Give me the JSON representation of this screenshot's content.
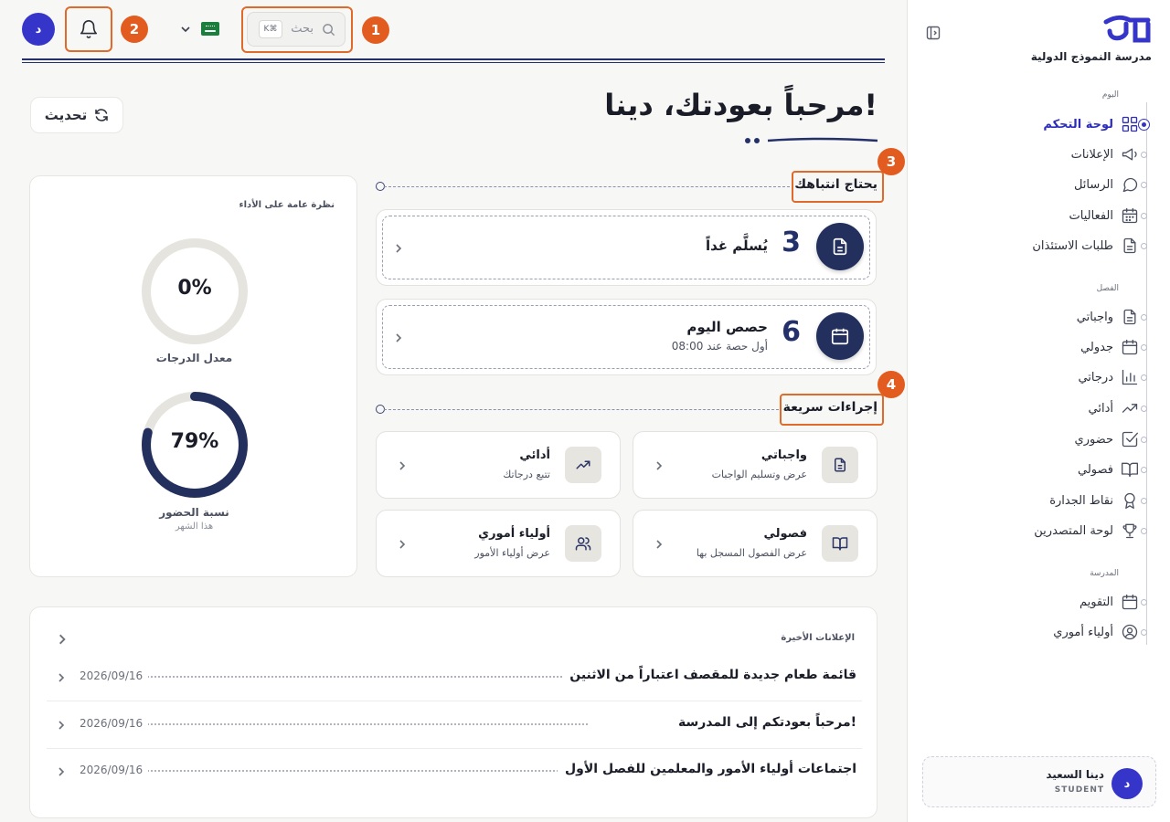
{
  "sidebar": {
    "school_name": "مدرسة النموذج الدولية",
    "sections": {
      "today": "اليوم",
      "class": "الفصل",
      "school": "المدرسة"
    },
    "items": [
      {
        "label": "لوحة التحكم",
        "icon": "dashboard-grid-icon",
        "active": true
      },
      {
        "label": "الإعلانات",
        "icon": "megaphone-icon"
      },
      {
        "label": "الرسائل",
        "icon": "message-bubble-icon"
      },
      {
        "label": "الفعاليات",
        "icon": "calendar-grid-icon"
      },
      {
        "label": "طلبات الاستئذان",
        "icon": "document-icon"
      },
      {
        "label": "واجباتي",
        "icon": "document-icon"
      },
      {
        "label": "جدولي",
        "icon": "calendar-icon"
      },
      {
        "label": "درجاتي",
        "icon": "bar-chart-icon"
      },
      {
        "label": "أدائي",
        "icon": "trending-up-icon"
      },
      {
        "label": "حضوري",
        "icon": "checkbox-icon"
      },
      {
        "label": "فصولي",
        "icon": "open-book-icon"
      },
      {
        "label": "نقاط الجدارة",
        "icon": "award-ribbon-icon"
      },
      {
        "label": "لوحة المتصدرين",
        "icon": "trophy-icon"
      },
      {
        "label": "التقويم",
        "icon": "calendar-icon"
      },
      {
        "label": "أولياء أموري",
        "icon": "user-circle-icon"
      }
    ],
    "user": {
      "initial": "د",
      "name": "دينا السعيد",
      "role": "STUDENT"
    }
  },
  "topbar": {
    "avatar_initial": "د",
    "search_placeholder": "بحث",
    "search_shortcut": "K⌘",
    "badges": [
      "1",
      "2",
      "3",
      "4"
    ]
  },
  "header": {
    "welcome": "مرحباً بعودتك، دينا!",
    "refresh_label": "تحديث"
  },
  "performance": {
    "title": "نظرة عامة على الأداء",
    "grade_avg": {
      "value": "0%",
      "fraction": 0,
      "label": "معدل الدرجات"
    },
    "attendance": {
      "value": "79%",
      "fraction": 0.79,
      "label": "نسبة الحضور",
      "sub": "هذا الشهر"
    }
  },
  "attention": {
    "title": "يحتاج انتباهك",
    "cards": [
      {
        "count": "3",
        "title": "يُسلَّم غداً",
        "sub": ""
      },
      {
        "count": "6",
        "title": "حصص اليوم",
        "sub": "أول حصة عند 08:00"
      }
    ]
  },
  "quick_actions": {
    "title": "إجراءات سريعة",
    "items": [
      {
        "title": "واجباتي",
        "sub": "عرض وتسليم الواجبات",
        "icon": "document-icon"
      },
      {
        "title": "أدائي",
        "sub": "تتبع درجاتك",
        "icon": "trending-up-icon"
      },
      {
        "title": "فصولي",
        "sub": "عرض الفصول المسجل بها",
        "icon": "open-book-icon"
      },
      {
        "title": "أولياء أموري",
        "sub": "عرض أولياء الأمور",
        "icon": "users-icon"
      }
    ]
  },
  "announcements": {
    "title": "الإعلانات الأخيرة",
    "items": [
      {
        "title": "قائمة طعام جديدة للمقصف اعتباراً من الاثنين",
        "date": "2026/09/16"
      },
      {
        "title": "مرحباً بعودتكم إلى المدرسة!",
        "date": "2026/09/16"
      },
      {
        "title": "اجتماعات أولياء الأمور والمعلمين للفصل الأول",
        "date": "2026/09/16"
      }
    ]
  },
  "colors": {
    "primary": "#3535c9",
    "navy": "#23305e",
    "highlight": "#e06a2a",
    "badge": "#e35c1f"
  }
}
